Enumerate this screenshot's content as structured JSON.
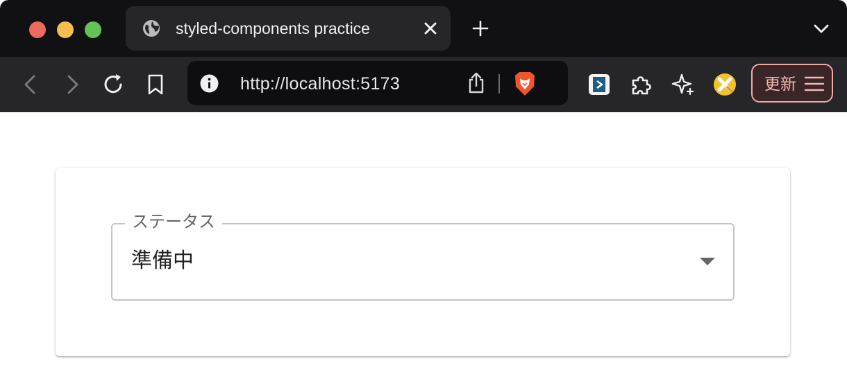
{
  "browser": {
    "tab": {
      "title": "styled-components practice",
      "icon": "globe-icon"
    },
    "url": "http://localhost:5173",
    "update_button": {
      "label": "更新"
    }
  },
  "page": {
    "select": {
      "label": "ステータス",
      "value": "準備中"
    }
  },
  "colors": {
    "tabbar_bg": "#111114",
    "toolbar_bg": "#25252a",
    "update_accent": "#f0a9a4"
  }
}
